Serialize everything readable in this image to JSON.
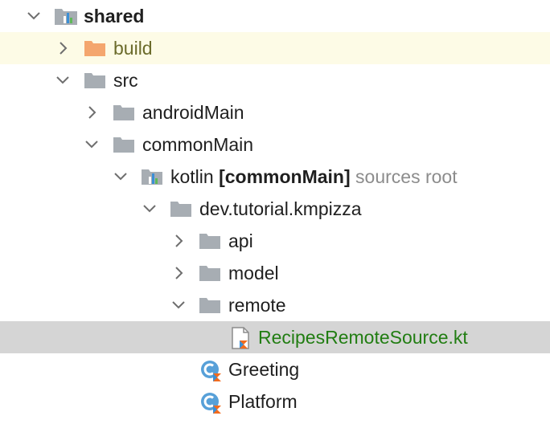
{
  "tree": {
    "shared": {
      "label": "shared",
      "icon": "module-folder-icon"
    },
    "build": {
      "label": "build",
      "icon": "excluded-folder-icon",
      "color": "#f4a66e"
    },
    "src": {
      "label": "src",
      "icon": "folder-icon"
    },
    "androidMain": {
      "label": "androidMain",
      "icon": "folder-icon"
    },
    "commonMain": {
      "label": "commonMain",
      "icon": "folder-icon"
    },
    "kotlin": {
      "label": "kotlin",
      "module": "[commonMain]",
      "hint": "sources root",
      "icon": "source-root-icon"
    },
    "package": {
      "label": "dev.tutorial.kmpizza",
      "icon": "package-folder-icon"
    },
    "api": {
      "label": "api",
      "icon": "folder-icon"
    },
    "model": {
      "label": "model",
      "icon": "folder-icon"
    },
    "remote": {
      "label": "remote",
      "icon": "folder-icon"
    },
    "recipes": {
      "label": "RecipesRemoteSource.kt",
      "icon": "kotlin-file-icon",
      "color": "#217d12"
    },
    "greeting": {
      "label": "Greeting",
      "icon": "kotlin-class-icon"
    },
    "platform": {
      "label": "Platform",
      "icon": "kotlin-class-icon"
    }
  },
  "colors": {
    "folder": "#a7adb3",
    "selection": "#d5d5d5",
    "excluded_row": "#fdfbe6",
    "kotlin_orange": "#f26b1d",
    "kotlin_blue": "#3b8fd6"
  }
}
